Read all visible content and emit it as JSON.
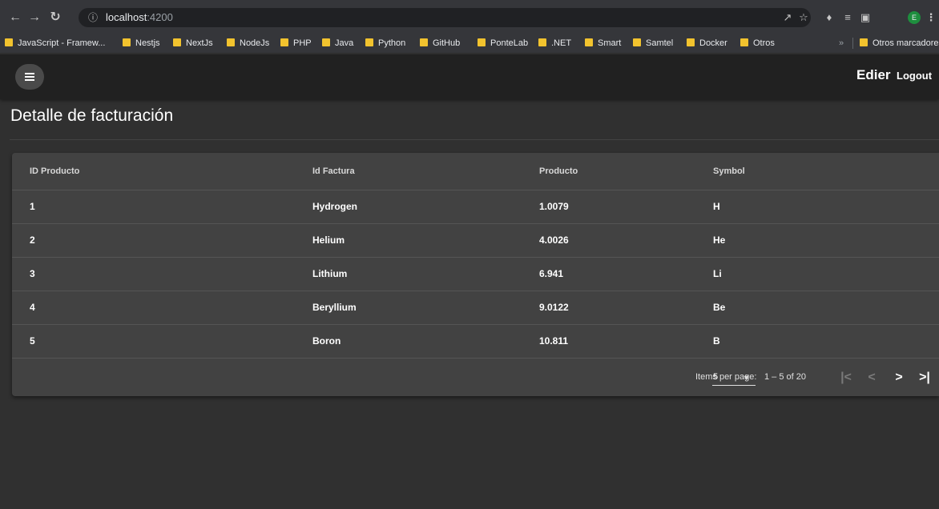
{
  "browser": {
    "url_host": "localhost",
    "url_port": ":4200",
    "profile_initial": "E",
    "bookmarks": [
      {
        "label": "JavaScript - Framew..."
      },
      {
        "label": "Nestjs"
      },
      {
        "label": "NextJs"
      },
      {
        "label": "NodeJs"
      },
      {
        "label": "PHP"
      },
      {
        "label": "Java"
      },
      {
        "label": "Python"
      },
      {
        "label": "GitHub"
      },
      {
        "label": "PonteLab"
      },
      {
        "label": ".NET"
      },
      {
        "label": "Smart"
      },
      {
        "label": "Samtel"
      },
      {
        "label": "Docker"
      },
      {
        "label": "Otros"
      }
    ],
    "other_bookmarks": "Otros marcadores",
    "folder_color": "#f2c32e"
  },
  "header": {
    "user_name": "Edier",
    "logout_label": "Logout"
  },
  "page": {
    "title": "Detalle de facturación"
  },
  "table": {
    "columns": [
      "ID Producto",
      "Id Factura",
      "Producto",
      "Symbol"
    ],
    "rows": [
      [
        "1",
        "Hydrogen",
        "1.0079",
        "H"
      ],
      [
        "2",
        "Helium",
        "4.0026",
        "He"
      ],
      [
        "3",
        "Lithium",
        "6.941",
        "Li"
      ],
      [
        "4",
        "Beryllium",
        "9.0122",
        "Be"
      ],
      [
        "5",
        "Boron",
        "10.811",
        "B"
      ]
    ]
  },
  "paginator": {
    "items_per_page_label": "Items per page:",
    "page_size": "5",
    "range_label": "1 – 5 of 20"
  },
  "colors": {
    "background": "#303030",
    "app_bar": "#212121",
    "card": "#424242"
  }
}
